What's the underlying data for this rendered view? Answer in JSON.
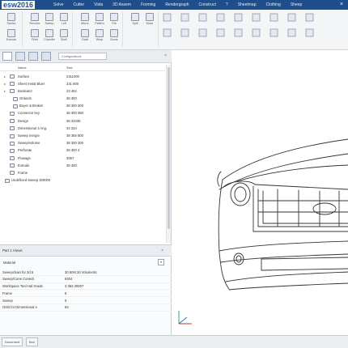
{
  "app": {
    "logo_text": "esw2016"
  },
  "menu": {
    "items": [
      "Solve",
      "Cutter",
      "Vista",
      "3D Assem",
      "Forming",
      "Rendergraph",
      "Construct",
      "?",
      "Sheetmap",
      "Clothing",
      "Sheep"
    ]
  },
  "ribbon": {
    "buttons": [
      {
        "label": "Sketch"
      },
      {
        "label": "Extrude"
      },
      {
        "label": "Revolve"
      },
      {
        "label": "Sweep"
      },
      {
        "label": "Loft"
      },
      {
        "label": "Fillet"
      },
      {
        "label": "Chamfer"
      },
      {
        "label": "Shell"
      },
      {
        "label": "Mirror"
      },
      {
        "label": "Pattern"
      },
      {
        "label": "Rib"
      },
      {
        "label": "Draft"
      },
      {
        "label": "Wrap"
      },
      {
        "label": "Dome"
      },
      {
        "label": "Split"
      },
      {
        "label": "Move"
      }
    ]
  },
  "feature_tree": {
    "search_placeholder": "Configurations",
    "columns": {
      "name": "Name",
      "value": "Size"
    },
    "rows": [
      {
        "name": "Surface",
        "value": "2311000",
        "toggle": "▸"
      },
      {
        "name": "Sheet metal Bluer",
        "value": "231 800",
        "toggle": "▸"
      },
      {
        "name": "Boolean2",
        "value": "23 452",
        "toggle": "▸"
      },
      {
        "name": "Orlando",
        "value": "38 300",
        "toggle": ""
      },
      {
        "name": "Buyer & Broken",
        "value": "38 300 300",
        "toggle": ""
      },
      {
        "name": "Connector key",
        "value": "38 300 380",
        "toggle": ""
      },
      {
        "name": "Design",
        "value": "38 33335",
        "toggle": ""
      },
      {
        "name": "Dimensional 3 Ang.",
        "value": "34 334",
        "toggle": ""
      },
      {
        "name": "Sweep mergie",
        "value": "38 365 800",
        "toggle": ""
      },
      {
        "name": "Sweep/volume",
        "value": "38 300 300",
        "toggle": ""
      },
      {
        "name": "Perforate",
        "value": "39 300 4",
        "toggle": ""
      },
      {
        "name": "Flowage",
        "value": "3097",
        "toggle": ""
      },
      {
        "name": "Extrude",
        "value": "38 300",
        "toggle": ""
      },
      {
        "name": "Frame",
        "value": "",
        "toggle": ""
      },
      {
        "name": "Undefined Sweep 300000",
        "value": "",
        "toggle": ""
      }
    ]
  },
  "properties": {
    "title": "Part 1 Views",
    "category": "Material",
    "rows": [
      {
        "key": "Sweepchain for 3d 5",
        "value": "30 50st 3d Volumetric"
      },
      {
        "key": "Sweep/Cone Conecti",
        "value": "8304"
      },
      {
        "key": "Workspace Tool Hal Grade",
        "value": "3 363 30007"
      },
      {
        "key": "Frame",
        "value": "8"
      },
      {
        "key": "Sweep",
        "value": "9"
      },
      {
        "key": "Orbit for Dimensional A",
        "value": "84"
      }
    ]
  },
  "status_tabs": [
    "Document",
    "Box"
  ],
  "colors": {
    "titlebar": "#1f4e8c",
    "accent": "#1f4e8c"
  }
}
